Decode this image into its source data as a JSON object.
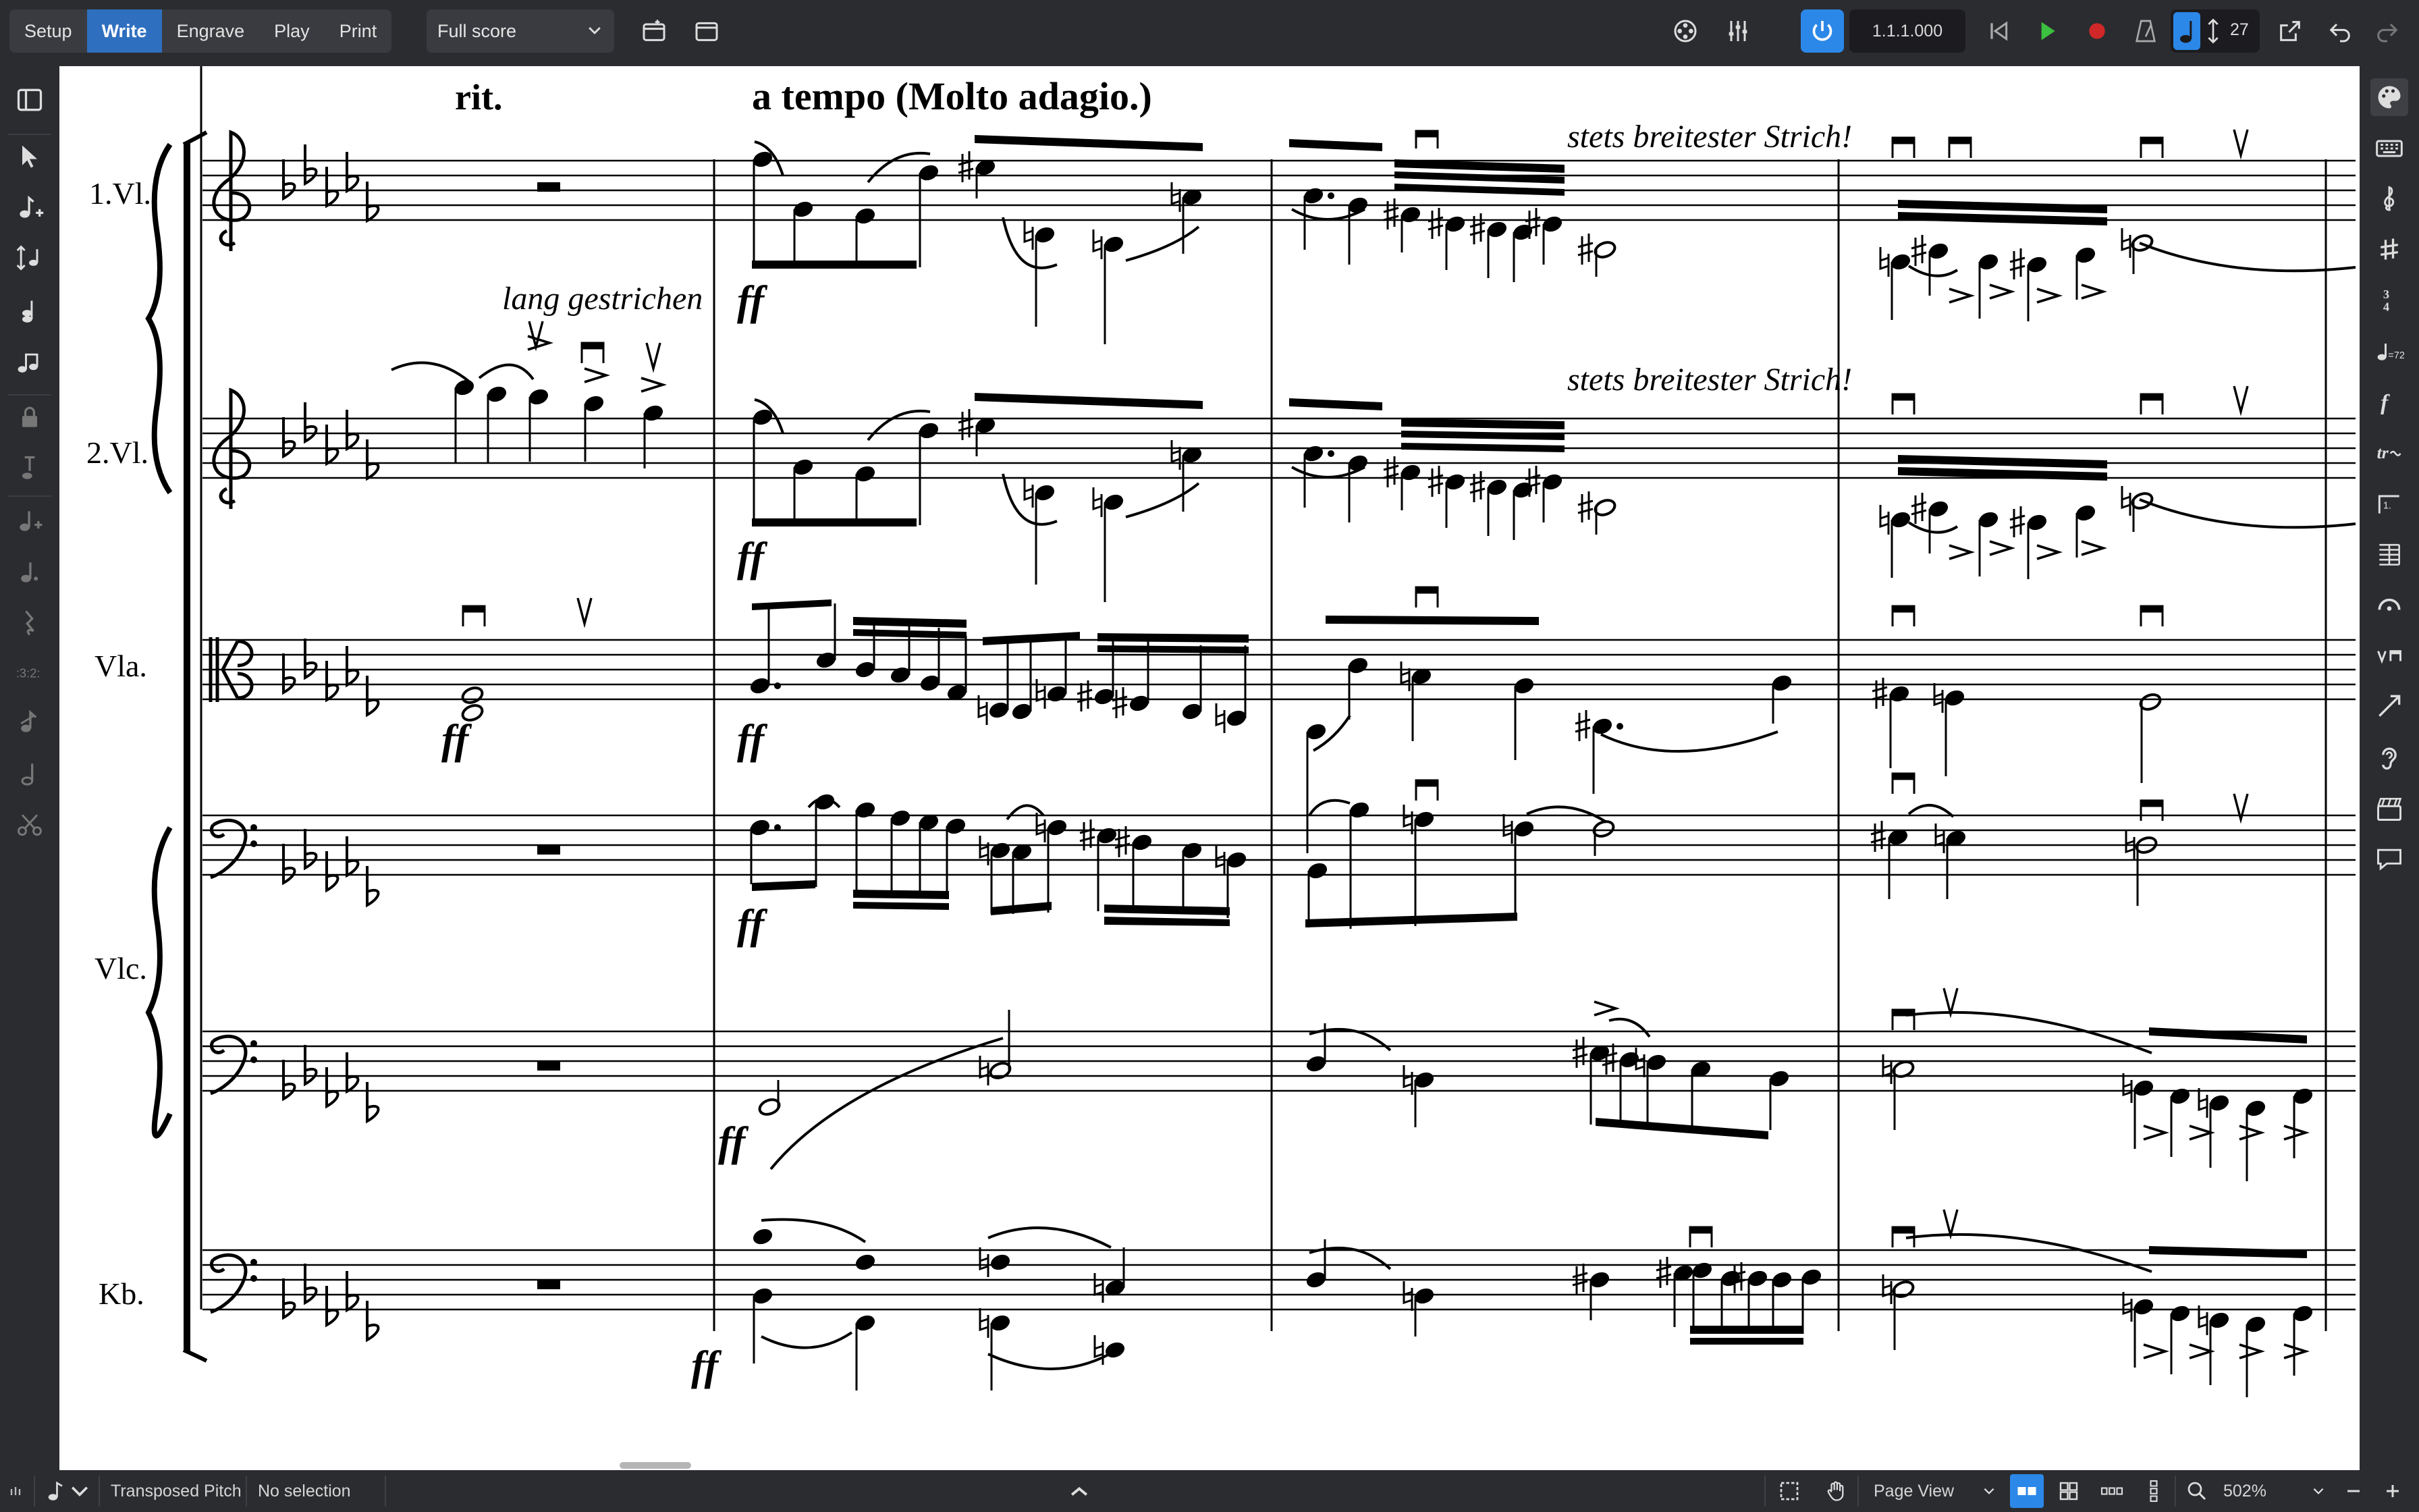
{
  "toolbar": {
    "modes": [
      {
        "label": "Setup"
      },
      {
        "label": "Write"
      },
      {
        "label": "Engrave"
      },
      {
        "label": "Play"
      },
      {
        "label": "Print"
      }
    ],
    "active_mode": "Write",
    "layout": "Full score",
    "position": "1.1.1.000",
    "tempo": "27",
    "accent": "#2b88e8"
  },
  "score": {
    "tempo_marks": [
      "rit.",
      "a tempo (Molto adagio.)"
    ],
    "text_marks": [
      "lang gestrichen",
      "stets breitester Strich!",
      "stets breitester Strich!"
    ],
    "instruments": [
      "1.Vl.",
      "2.Vl.",
      "Vla.",
      "Vlc.",
      "Kb."
    ],
    "dynamic": "ff"
  },
  "statusbar": {
    "pitch_mode": "Transposed Pitch",
    "selection": "No selection",
    "view": "Page View",
    "zoom": "502%"
  }
}
